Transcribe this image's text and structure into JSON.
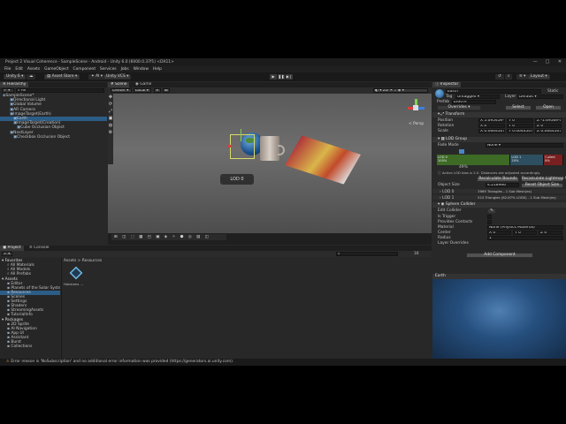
{
  "window": {
    "title": "Project 2 Visual Coherence - SampleScene - Android - Unity 6.0 (6000.0.37f1) <DX11>",
    "controls": [
      "—",
      "□",
      "✕"
    ]
  },
  "menu": [
    "File",
    "Edit",
    "Assets",
    "GameObject",
    "Component",
    "Services",
    "Jobs",
    "Window",
    "Help"
  ],
  "toolbar": {
    "account": "Unity 6",
    "asset_store": "Asset Store",
    "vcs": "Unity VCS",
    "layout": "Layout"
  },
  "hierarchy": {
    "tab": "Hierarchy",
    "search_placeholder": "All",
    "items": [
      {
        "label": "SampleScene*",
        "indent": 0
      },
      {
        "label": "Directional Light",
        "indent": 2
      },
      {
        "label": "Global Volume",
        "indent": 2
      },
      {
        "label": "AR Camera",
        "indent": 2
      },
      {
        "label": "ImageTarget(Earth)",
        "indent": 2
      },
      {
        "label": "Earth",
        "indent": 3,
        "selected": true
      },
      {
        "label": "ImageTarget(Creation)",
        "indent": 3
      },
      {
        "label": "Cube Occlusion Object",
        "indent": 4
      },
      {
        "label": "NextLayer",
        "indent": 2
      },
      {
        "label": "Checkbox Occlusion Object",
        "indent": 3
      }
    ]
  },
  "scene": {
    "tabs": [
      "Scene",
      "Game"
    ],
    "shading": "Center",
    "local": "Local",
    "persp": "< Persp",
    "lod_label": "LOD 0"
  },
  "project": {
    "tabs": [
      "Project",
      "Console"
    ],
    "breadcrumb": "Assets  >  Resources",
    "favorites_title": "Favorites",
    "favorites": [
      "All Materials",
      "All Models",
      "All Prefabs"
    ],
    "assets_title": "Assets",
    "assets": [
      "Editor",
      "Planets of the Solar Syste",
      "Resources",
      "Scenes",
      "Settings",
      "Shaders",
      "StreamingAssets",
      "TutorialInfo"
    ],
    "packages_title": "Packages",
    "packages": [
      "2D Sprite",
      "AI Navigation",
      "App UI",
      "Assistant",
      "Burst",
      "Collections"
    ],
    "file_label": "HoloLens ...",
    "count": "16"
  },
  "inspector": {
    "tab": "Inspector",
    "name": "Earth",
    "static": "Static",
    "tag": "Untagged",
    "tag_label": "Tag",
    "layer_label": "Layer",
    "layer": "Default",
    "prefab_label": "Prefab",
    "prefab": "EARTH",
    "overrides": "Overrides",
    "select": "Select",
    "open": "Open",
    "transform": {
      "title": "Transform",
      "position": [
        "X 5.09545e-06",
        "Y 0",
        "Z -1.6956e-0"
      ],
      "rotation": [
        "X 0",
        "Y 0",
        "Z 0"
      ],
      "scale": [
        "X 0.06445077",
        "Y 0.06445077",
        "Z 0.06445077"
      ],
      "labels": [
        "Position",
        "Rotation",
        "Scale"
      ]
    },
    "lod_group": {
      "title": "LOD Group",
      "fade_mode_label": "Fade Mode",
      "fade_mode": "None",
      "segments": [
        {
          "label": "LOD 0",
          "pct": "100%",
          "color": "#3d6a25"
        },
        {
          "label": "LOD 1",
          "pct": "20%",
          "color": "#2d4f60"
        },
        {
          "label": "Culled",
          "pct": "8%",
          "color": "#7a1f1f"
        }
      ],
      "slider_value": "49%",
      "warning": "Active LOD bias is 2.0. Distances are adjusted accordingly.",
      "recalc_bounds": "Recalculate Bounds",
      "recalc_lightmap": "Recalculate Lightmap Scale",
      "object_size_label": "Object Size",
      "object_size": "4.218966",
      "reset_size": "Reset Object Size",
      "lods": [
        {
          "label": "LOD 0",
          "info": "3969 Triangles  - 1 Sub Mesh(es)"
        },
        {
          "label": "LOD 1",
          "info": "515 Triangles  (62.67% LOD0) - 1 Sub Mesh(es)"
        }
      ]
    },
    "sphere_collider": {
      "title": "Sphere Collider",
      "edit_label": "Edit Collider",
      "fields": [
        "Is Trigger",
        "Provides Contacts",
        "Material",
        "Center",
        "Radius",
        "Layer Overrides"
      ],
      "material": "None (Physics Material)",
      "center": [
        "X 0",
        "Y 0",
        "Z 0"
      ],
      "radius": "1"
    },
    "add_component": "Add Component",
    "preview_title": "Earth"
  },
  "status": "Error reason is 'NoSubscription' and no additional error information was provided (https://generators.ai.unity.com)."
}
